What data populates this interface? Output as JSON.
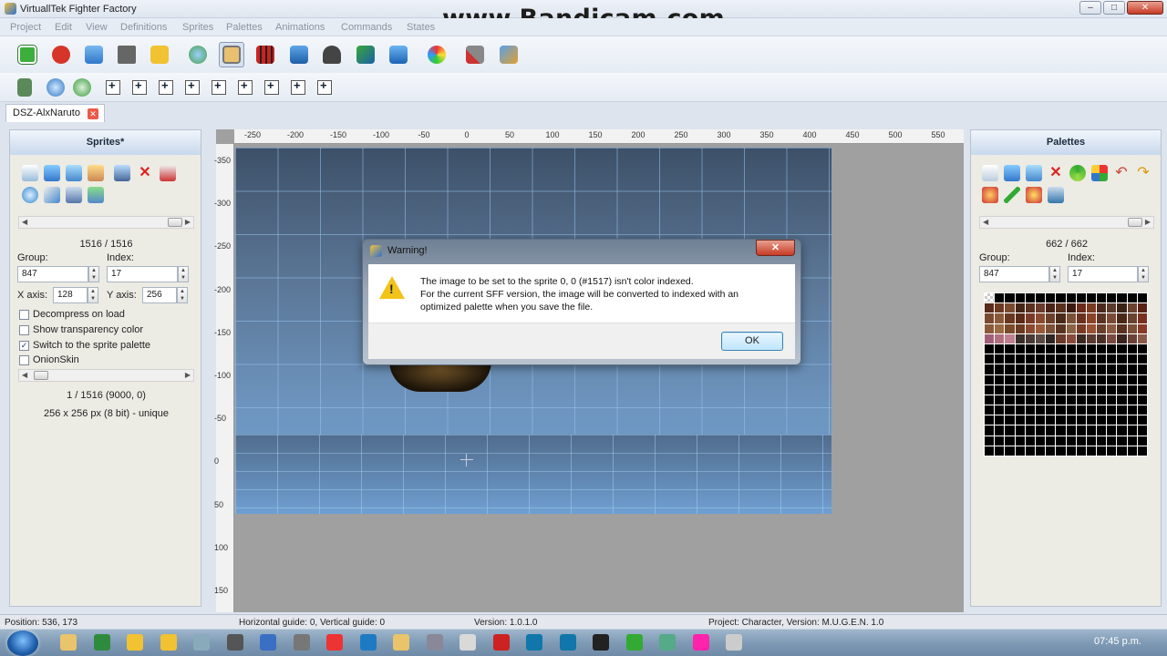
{
  "window": {
    "title": "VirtuallTek Fighter Factory",
    "minimize": "–",
    "maximize": "□",
    "close": "✕"
  },
  "watermark": "www.Bandicam.com",
  "menu": [
    "Project",
    "Edit",
    "View",
    "Definitions",
    "Sprites",
    "Palettes",
    "Animations",
    "Commands",
    "States"
  ],
  "doc_tab": {
    "label": "DSZ-AlxNaruto",
    "close": "✕"
  },
  "sprites_panel": {
    "title": "Sprites*",
    "count": "1516 / 1516",
    "group_label": "Group:",
    "group_value": "847",
    "index_label": "Index:",
    "index_value": "17",
    "xaxis_label": "X axis:",
    "xaxis_value": "128",
    "yaxis_label": "Y axis:",
    "yaxis_value": "256",
    "checks": [
      {
        "label": "Decompress on load",
        "checked": false
      },
      {
        "label": "Show transparency color",
        "checked": false
      },
      {
        "label": "Switch to the sprite palette",
        "checked": true
      },
      {
        "label": "OnionSkin",
        "checked": false
      }
    ],
    "position_info": "1 / 1516 (9000, 0)",
    "size_info": "256 x 256 px (8 bit) - unique"
  },
  "palettes_panel": {
    "title": "Palettes",
    "count": "662 / 662",
    "group_label": "Group:",
    "group_value": "847",
    "index_label": "Index:",
    "index_value": "17",
    "colored_rows": [
      [
        "#5a2a1a",
        "#6b3a22",
        "#7a4a30",
        "#452616",
        "#5a3020",
        "#6a3a2a",
        "#4a2418",
        "#58301e",
        "#3a1a10",
        "#6a2a1a",
        "#7a3a22",
        "#4a2a1c",
        "#5a3a2a",
        "#3a2216",
        "#6a4230",
        "#5a2216"
      ],
      [
        "#7a4a30",
        "#8a5a38",
        "#6a3820",
        "#5a2a18",
        "#7a3a28",
        "#8a4a30",
        "#6a402a",
        "#4a2a1a",
        "#7a5238",
        "#6a3020",
        "#8a4228",
        "#5a3422",
        "#7a4a36",
        "#4a2818",
        "#6a4232",
        "#7a3020"
      ],
      [
        "#8a5a3a",
        "#9a6a42",
        "#7a4a2a",
        "#6a3a22",
        "#8a4a30",
        "#9a5a38",
        "#7a5036",
        "#5a3422",
        "#8a6244",
        "#7a3a26",
        "#9a5032",
        "#6a402a",
        "#8a5a40",
        "#5a3020",
        "#7a5038",
        "#8a3a26"
      ],
      [
        "#a0607a",
        "#b07080",
        "#c08090",
        "#3a2e2a",
        "#4a3a34",
        "#5a4a44",
        "#2e2622",
        "#6a3a2a",
        "#8a4a3a",
        "#3a2a22",
        "#5a3a30",
        "#4a3028",
        "#7a4a40",
        "#3a2420",
        "#6a4238",
        "#8a5a48"
      ]
    ]
  },
  "ruler_x": [
    "-250",
    "-200",
    "-150",
    "-100",
    "-50",
    "0",
    "50",
    "100",
    "150",
    "200",
    "250",
    "300",
    "350",
    "400",
    "450",
    "500",
    "550"
  ],
  "ruler_y": [
    "-350",
    "-300",
    "-250",
    "-200",
    "-150",
    "-100",
    "-50",
    "0",
    "50",
    "100",
    "150"
  ],
  "dialog": {
    "title": "Warning!",
    "close": "✕",
    "line1": "The image to be set to the sprite 0, 0 (#1517) isn't color indexed.",
    "line2": "For the current SFF version, the image will be converted to indexed with an",
    "line3": "optimized palette when you save the file.",
    "ok": "OK"
  },
  "status": {
    "position": "Position: 536, 173",
    "guides": "Horizontal guide: 0, Vertical guide: 0",
    "version": "Version: 1.0.1.0",
    "project": "Project: Character, Version: M.U.G.E.N. 1.0"
  },
  "taskbar": {
    "clock": "07:45 p.m."
  },
  "colors": {
    "accent": "#6fa0d0",
    "panel_head": "#c9d8ec",
    "warning": "#f2c318"
  }
}
